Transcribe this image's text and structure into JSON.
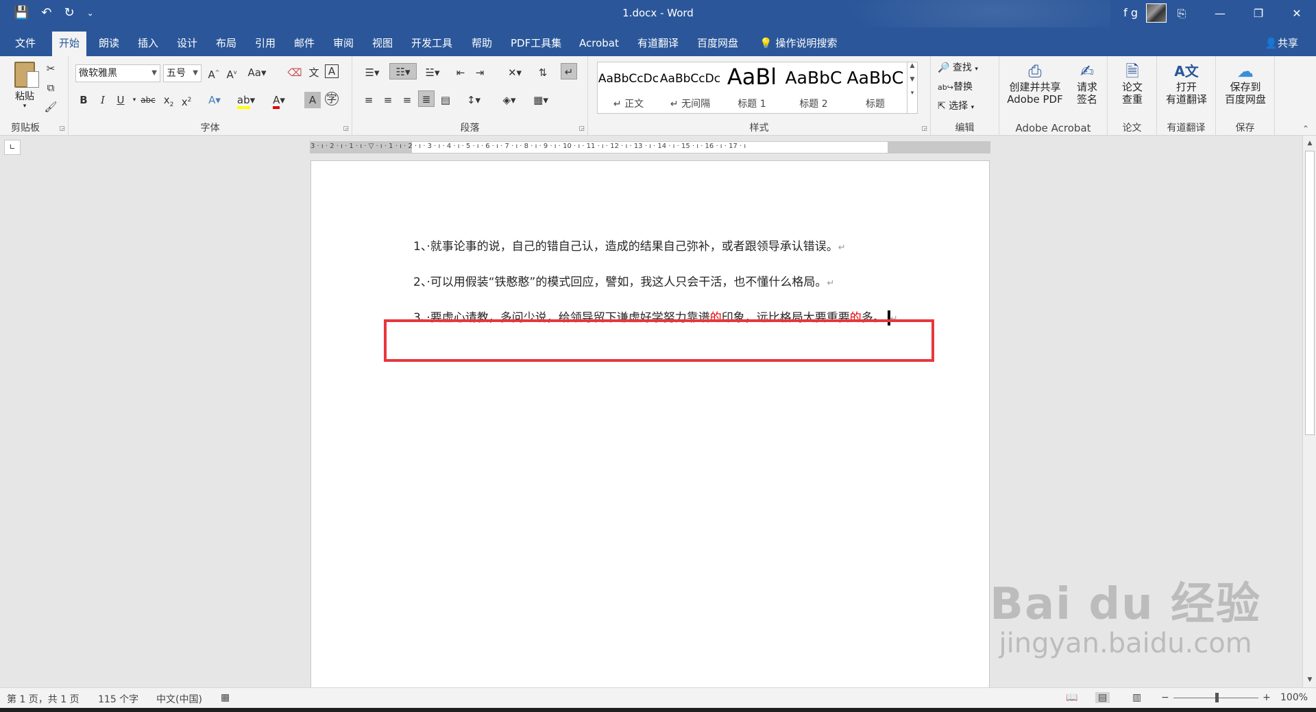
{
  "window": {
    "title": "1.docx  -  Word",
    "user": "f g",
    "controls": [
      "⎘",
      "—",
      "❐",
      "✕"
    ]
  },
  "qat": {
    "save_icon": "💾",
    "undo_icon": "↶",
    "redo_icon": "↻",
    "more_icon": "⌄"
  },
  "tabs": [
    {
      "label": "文件"
    },
    {
      "label": "开始"
    },
    {
      "label": "朗读"
    },
    {
      "label": "插入"
    },
    {
      "label": "设计"
    },
    {
      "label": "布局"
    },
    {
      "label": "引用"
    },
    {
      "label": "邮件"
    },
    {
      "label": "审阅"
    },
    {
      "label": "视图"
    },
    {
      "label": "开发工具"
    },
    {
      "label": "帮助"
    },
    {
      "label": "PDF工具集"
    },
    {
      "label": "Acrobat"
    },
    {
      "label": "有道翻译"
    },
    {
      "label": "百度网盘"
    }
  ],
  "tellme": "操作说明搜索",
  "share": "共享",
  "ribbon": {
    "clipboard": {
      "label": "剪贴板",
      "paste": "粘贴"
    },
    "font": {
      "label": "字体",
      "font_name": "微软雅黑",
      "font_size": "五号"
    },
    "paragraph": {
      "label": "段落"
    },
    "styles": {
      "label": "样式",
      "items": [
        {
          "sample": "AaBbCcDc",
          "name": "↵ 正文"
        },
        {
          "sample": "AaBbCcDc",
          "name": "↵ 无间隔"
        },
        {
          "sample": "AaBl",
          "name": "标题 1"
        },
        {
          "sample": "AaBbC",
          "name": "标题 2"
        },
        {
          "sample": "AaBbC",
          "name": "标题"
        }
      ]
    },
    "editing": {
      "label": "编辑",
      "find": "查找",
      "replace": "替换",
      "select": "选择"
    },
    "acrobat": {
      "label": "Adobe Acrobat",
      "create_line1": "创建并共享",
      "create_line2": "Adobe PDF",
      "sign_line1": "请求",
      "sign_line2": "签名"
    },
    "paper": {
      "label": "论文",
      "check_line1": "论文",
      "check_line2": "查重"
    },
    "youdao": {
      "label": "有道翻译",
      "open_line1": "打开",
      "open_line2": "有道翻译"
    },
    "save": {
      "label": "保存",
      "save_line1": "保存到",
      "save_line2": "百度网盘"
    }
  },
  "ruler": {
    "numbers": "3 · ı · 2 · ı · 1 · ı · ▽ · ı · 1 · ı · 2 · ı · 3 · ı · 4 · ı · 5 · ı · 6 · ı · 7 · ı · 8 · ı · 9 · ı · 10 · ı · 11 · ı · 12 · ı · 13 · ı · 14 · ı · 15 · ı · 16 · ı · 17 · ı"
  },
  "document": {
    "para1": "1、·就事论事的说，自己的错自己认，造成的结果自己弥补，或者跟领导承认错误。",
    "para2": "2、·可以用假装“铁憨憨”的模式回应，譬如，我这人只会干活，也不懂什么格局。",
    "para3_a": "3、·要虚心请教，多问少说，给领导留下谦虚好学努力靠谱",
    "para3_b": "的",
    "para3_c": "印象，远比格局大要重要",
    "para3_d": "的",
    "para3_e": "多。",
    "para_mark": "↵"
  },
  "status": {
    "page": "第 1 页，共 1 页",
    "words": "115 个字",
    "language": "中文(中国)",
    "zoom": "100%"
  },
  "watermark": {
    "brand": "Bai du 经验",
    "url": "jingyan.baidu.com"
  },
  "colors": {
    "word_blue": "#2b579a",
    "highlight_red": "#e8363d",
    "text_red": "#e00000"
  }
}
